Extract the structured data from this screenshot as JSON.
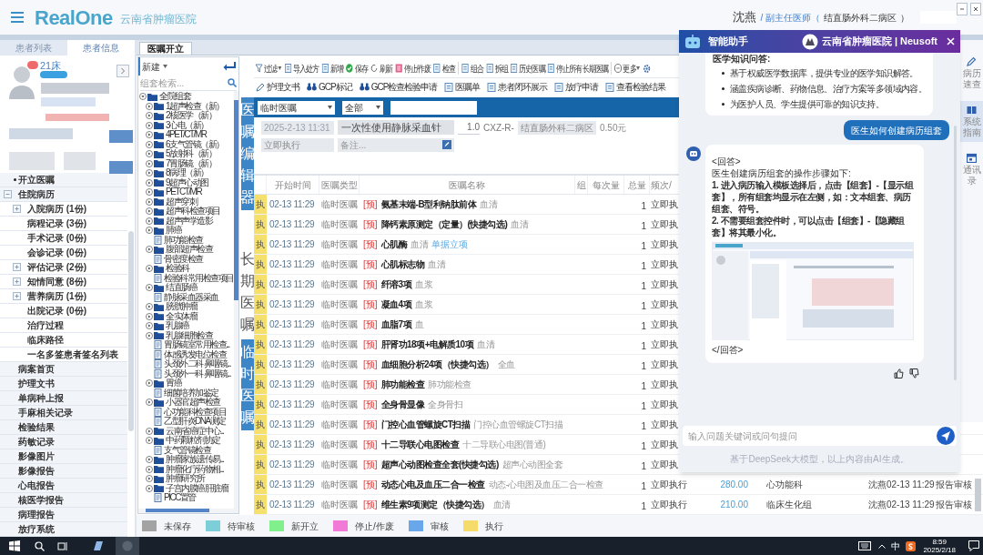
{
  "header": {
    "logo": "RealOne",
    "hospital": "云南省肿瘤医院",
    "user": "沈燕",
    "user_title": "/ 副主任医师（",
    "department": "结直肠外科二病区",
    "closing": "）"
  },
  "patient_tabs": [
    {
      "label": "患者列表",
      "selected": false
    },
    {
      "label": "患者信息",
      "selected": true
    }
  ],
  "patient": {
    "bed": "21床"
  },
  "nav": [
    {
      "label": "开立医嘱",
      "selected": true
    },
    {
      "label": "住院病历",
      "selected": false,
      "expanded": true,
      "children": [
        {
          "label": "入院病历 (1份)",
          "selected": false,
          "expanded": false
        },
        {
          "label": "病程记录 (3份)",
          "selected": false
        },
        {
          "label": "手术记录 (0份)",
          "selected": false
        },
        {
          "label": "会诊记录 (0份)",
          "selected": false
        },
        {
          "label": "评估记录 (2份)",
          "selected": false,
          "expanded": false
        },
        {
          "label": "知情同意 (8份)",
          "selected": false,
          "expanded": false
        },
        {
          "label": "营养病历 (1份)",
          "selected": false,
          "expanded": false
        },
        {
          "label": "出院记录 (0份)",
          "selected": false
        },
        {
          "label": "治疗过程",
          "selected": false
        },
        {
          "label": "临床路径",
          "selected": false
        },
        {
          "label": "一名多签患者签名列表",
          "selected": false
        }
      ]
    },
    {
      "label": "病案首页",
      "selected": false
    },
    {
      "label": "护理文书",
      "selected": false
    },
    {
      "label": "单病种上报",
      "selected": false
    },
    {
      "label": "手麻相关记录",
      "selected": false
    },
    {
      "label": "检验结果",
      "selected": false
    },
    {
      "label": "药敏记录",
      "selected": false
    },
    {
      "label": "影像图片",
      "selected": false
    },
    {
      "label": "影像报告",
      "selected": false
    },
    {
      "label": "心电报告",
      "selected": false
    },
    {
      "label": "核医学报告",
      "selected": false
    },
    {
      "label": "病理报告",
      "selected": false
    },
    {
      "label": "放疗系统",
      "selected": false
    }
  ],
  "editor_tabs": [
    {
      "label": "医嘱开立",
      "selected": true
    }
  ],
  "group_panel": {
    "new_label": "新建",
    "search_placeholder": "组套检索...",
    "tree": [
      {
        "label": "全院组套",
        "kind": "folder",
        "expanded": true,
        "children": [
          {
            "label": "1超声检查（新）",
            "kind": "folder",
            "expanded": false
          },
          {
            "label": "2核医学（新）",
            "kind": "folder",
            "expanded": false
          },
          {
            "label": "3心电（新）",
            "kind": "folder",
            "expanded": false
          },
          {
            "label": "4PET/CT/MR",
            "kind": "folder",
            "expanded": false
          },
          {
            "label": "6支气管镜（新）",
            "kind": "folder",
            "expanded": false
          },
          {
            "label": "5放射科（新）",
            "kind": "folder",
            "expanded": false
          },
          {
            "label": "7胃肠镜（新）",
            "kind": "folder",
            "expanded": false
          },
          {
            "label": "8病理（新）",
            "kind": "folder",
            "expanded": false
          },
          {
            "label": "9超声心动图",
            "kind": "folder",
            "expanded": false
          },
          {
            "label": "PETCT/MR",
            "kind": "folder",
            "expanded": false
          },
          {
            "label": "超声穿刺",
            "kind": "folder",
            "expanded": false
          },
          {
            "label": "超声科检查项目",
            "kind": "folder",
            "expanded": false
          },
          {
            "label": "超声声学造影",
            "kind": "folder",
            "expanded": false
          },
          {
            "label": "肺癌",
            "kind": "folder",
            "expanded": false
          },
          {
            "label": "肺功能检查",
            "kind": "file"
          },
          {
            "label": "腹部超声检查",
            "kind": "folder",
            "expanded": false
          },
          {
            "label": "骨密度检查",
            "kind": "file"
          },
          {
            "label": "检验科",
            "kind": "folder",
            "expanded": false
          },
          {
            "label": "检验科常用检查项目",
            "kind": "file"
          },
          {
            "label": "结直肠癌",
            "kind": "folder",
            "expanded": false
          },
          {
            "label": "静脉采血器采血",
            "kind": "file"
          },
          {
            "label": "膀胱肿瘤",
            "kind": "folder",
            "expanded": false
          },
          {
            "label": "全实体瘤",
            "kind": "folder",
            "expanded": false
          },
          {
            "label": "乳腺癌",
            "kind": "folder",
            "expanded": false
          },
          {
            "label": "乳腺细胞检查",
            "kind": "folder",
            "expanded": false
          },
          {
            "label": "胃肠镜室常用检查...",
            "kind": "file"
          },
          {
            "label": "体感诱发电位检查",
            "kind": "file"
          },
          {
            "label": "头颈外二科 鼻咽镜...",
            "kind": "file"
          },
          {
            "label": "头颈外一科 鼻咽镜...",
            "kind": "file"
          },
          {
            "label": "胃癌",
            "kind": "folder",
            "expanded": false
          },
          {
            "label": "细菌培养加鉴定",
            "kind": "file"
          },
          {
            "label": "小器官超声检查",
            "kind": "folder",
            "expanded": false
          },
          {
            "label": "心功能科检查项目",
            "kind": "file"
          },
          {
            "label": "乙型肝炎DNA测定",
            "kind": "file"
          },
          {
            "label": "云南省癌症中心...",
            "kind": "folder",
            "expanded": false
          },
          {
            "label": "中药颗粒剂协定",
            "kind": "folder",
            "expanded": false
          },
          {
            "label": "支气管镜检查",
            "kind": "file"
          },
          {
            "label": "肿瘤家族遗传易...",
            "kind": "folder",
            "expanded": false
          },
          {
            "label": "肿瘤化疗药物相...",
            "kind": "folder",
            "expanded": false
          },
          {
            "label": "肿瘤研究所",
            "kind": "folder",
            "expanded": false
          },
          {
            "label": "子宫内膜癌肝脏瘤",
            "kind": "folder",
            "expanded": false
          },
          {
            "label": "PICC置管",
            "kind": "file"
          }
        ]
      }
    ]
  },
  "editor_panel_tab": "医嘱编辑器",
  "order_tabs": [
    {
      "label": "长期医嘱",
      "selected": false
    },
    {
      "label": "临时医嘱",
      "selected": true
    }
  ],
  "toolbar": [
    {
      "items": [
        {
          "label": "过滤",
          "menu": true
        },
        {
          "label": "导入处方",
          "menu": false
        },
        {
          "label": "新增",
          "menu": false
        },
        {
          "label": "保存",
          "menu": false
        },
        {
          "label": "刷新",
          "menu": false
        },
        {
          "label": "停止/作废",
          "menu": false
        },
        {
          "label": "检查",
          "menu": false
        }
      ]
    },
    {
      "items": [
        {
          "label": "组合",
          "menu": false
        },
        {
          "label": "拆组",
          "menu": false
        },
        {
          "label": "历史医嘱",
          "menu": false
        },
        {
          "label": "停止所有长期医嘱",
          "menu": false
        }
      ]
    },
    {
      "items": [
        {
          "label": "更多",
          "menu": true
        }
      ]
    }
  ],
  "toolbar_2": [
    "护理文书",
    "GCP标记",
    "GCP检查检验申请",
    "医嘱单",
    "患者闭环展示",
    "放疗申请",
    "查看检验结果"
  ],
  "filter_bar": {
    "order_type": "临时医嘱",
    "scope": "全部"
  },
  "entry": {
    "time": "2025-2-13 11:31",
    "item": "一次性使用静脉采血针",
    "dose": "1.0",
    "unit": "CXZ-R-",
    "ward": "结直肠外科二病区",
    "price": "0.50元",
    "frequency": "立即执行",
    "remark_placeholder": "备注..."
  },
  "table": {
    "columns": [
      "开始时间",
      "医嘱类型",
      "医嘱名称",
      "组",
      "每次量",
      "总量",
      "频次/"
    ],
    "rows": [
      {
        "status": "执",
        "color": "#f5e06e",
        "time": "02-13 11:29",
        "type": "临时医嘱",
        "tag": "[预]",
        "name": "氨基末端-B型利钠肽前体",
        "specimen": "血清",
        "total": "1",
        "frequency": "立即执"
      },
      {
        "status": "执",
        "color": "#f5e06e",
        "time": "02-13 11:29",
        "type": "临时医嘱",
        "tag": "[预]",
        "name": "降钙素原测定（定量）(快捷勾选)",
        "specimen": "血清",
        "total": "1",
        "frequency": "立即执"
      },
      {
        "status": "执",
        "color": "#f5e06e",
        "time": "02-13 11:29",
        "type": "临时医嘱",
        "tag": "[预]",
        "name": "心肌酶",
        "specimen": "血清",
        "note": "单据立项",
        "total": "1",
        "frequency": "立即执"
      },
      {
        "status": "执",
        "color": "#f5e06e",
        "time": "02-13 11:29",
        "type": "临时医嘱",
        "tag": "[预]",
        "name": "心肌标志物",
        "specimen": "血清",
        "total": "1",
        "frequency": "立即执"
      },
      {
        "status": "执",
        "color": "#f5e06e",
        "time": "02-13 11:29",
        "type": "临时医嘱",
        "tag": "[预]",
        "name": "纤溶3项",
        "specimen": "血浆",
        "total": "1",
        "frequency": "立即执"
      },
      {
        "status": "执",
        "color": "#f5e06e",
        "time": "02-13 11:29",
        "type": "临时医嘱",
        "tag": "[预]",
        "name": "凝血4项",
        "specimen": "血浆",
        "total": "1",
        "frequency": "立即执"
      },
      {
        "status": "执",
        "color": "#f5e06e",
        "time": "02-13 11:29",
        "type": "临时医嘱",
        "tag": "[预]",
        "name": "血脂7项",
        "specimen": "血",
        "total": "1",
        "frequency": "立即执"
      },
      {
        "status": "执",
        "color": "#f5e06e",
        "time": "02-13 11:29",
        "type": "临时医嘱",
        "tag": "[预]",
        "name": "肝肾功18项+电解质10项",
        "specimen": "血清",
        "total": "1",
        "frequency": "立即执"
      },
      {
        "status": "执",
        "color": "#f5e06e",
        "time": "02-13 11:29",
        "type": "临时医嘱",
        "tag": "[预]",
        "name": "血细胞分析24项（快捷勾选）",
        "specimen": "全血",
        "total": "1",
        "frequency": "立即执"
      },
      {
        "status": "执",
        "color": "#f5e06e",
        "time": "02-13 11:29",
        "type": "临时医嘱",
        "tag": "[预]",
        "name": "肺功能检查",
        "specimen": "肺功能检查",
        "total": "1",
        "frequency": "立即执"
      },
      {
        "status": "执",
        "color": "#f5e06e",
        "time": "02-13 11:29",
        "type": "临时医嘱",
        "tag": "[预]",
        "name": "全身骨显像",
        "specimen": "全身骨扫",
        "total": "1",
        "frequency": "立即执"
      },
      {
        "status": "执",
        "color": "#f5e06e",
        "time": "02-13 11:29",
        "type": "临时医嘱",
        "tag": "[预]",
        "name": "门控心血管螺旋CT扫描",
        "specimen": "门控心血管螺旋CT扫描",
        "total": "1",
        "frequency": "立即执"
      },
      {
        "status": "执",
        "color": "#f5e06e",
        "time": "02-13 11:29",
        "type": "临时医嘱",
        "tag": "[预]",
        "name": "十二导联心电图检查",
        "specimen": "十二导联心电图(普通)",
        "total": "1",
        "frequency": "立即执"
      },
      {
        "status": "执",
        "color": "#f5e06e",
        "time": "02-13 11:29",
        "type": "临时医嘱",
        "tag": "[预]",
        "name": "超声心动图检查全套(快捷勾选)",
        "specimen": "超声心动图全套",
        "total": "1",
        "frequency": "立即执"
      },
      {
        "status": "执",
        "color": "#f5e06e",
        "time": "02-13 11:29",
        "type": "临时医嘱",
        "tag": "[预]",
        "name": "动态心电及血压二合一检查",
        "specimen": "动态-心电图及血压二合一检查",
        "total": "1",
        "frequency": "立即执行",
        "price": "280.00",
        "dept": "心功能科",
        "signer": "沈燕02-13 11:29",
        "state": "报告审核"
      },
      {
        "status": "执",
        "color": "#f5e06e",
        "time": "02-13 11:29",
        "type": "临时医嘱",
        "tag": "[预]",
        "name": "维生素9项测定（快捷勾选）",
        "specimen": "血清",
        "total": "1",
        "frequency": "立即执行",
        "price": "210.00",
        "dept": "临床生化组",
        "signer": "沈燕02-13 11:29",
        "state": "报告审核"
      }
    ]
  },
  "legend": [
    {
      "label": "未保存",
      "color": "#a3a3a3"
    },
    {
      "label": "待审核",
      "color": "#7ccfd9"
    },
    {
      "label": "新开立",
      "color": "#7ff08c"
    },
    {
      "label": "停止/作废",
      "color": "#f07ad6"
    },
    {
      "label": "审核",
      "color": "#6aa7ea"
    },
    {
      "label": "执行",
      "color": "#f5dc6a"
    }
  ],
  "assistant": {
    "title": "智能助手",
    "brand": "云南省肿瘤医院 | Neusoft",
    "knowledge_card": {
      "title": "医学知识问答:",
      "bullets": [
        "基于权威医学数据库，提供专业的医学知识解答。",
        "涵盖疾病诊断、药物信息、治疗方案等多领域内容。",
        "为医护人员、学生提供可靠的知识支持。"
      ]
    },
    "question": "医生如何创建病历组套",
    "answer": {
      "open_tag": "<回答>",
      "intro": "医生创建病历组套的操作步骤如下:",
      "steps": [
        "1. 进入病历输入模板选择后，点击【组套】-【显示组套】，所有组套均显示在左侧，如：文本组套、病历组套、符号。",
        "2. 不需要组套控件时，可以点击【组套】-【隐藏组套】将其最小化。"
      ],
      "close_tag": "</回答>"
    },
    "input_placeholder": "输入问题关键词或问句提问",
    "footer": "基于DeepSeek大模型，以上内容由AI生成。"
  },
  "right_rail": [
    {
      "label": "病历速查",
      "selected": false
    },
    {
      "label": "系统指南",
      "selected": true
    },
    {
      "label": "通讯录",
      "selected": false
    }
  ],
  "taskbar": {
    "ime": "中",
    "time": "8:59",
    "date": "2025/2/18"
  }
}
